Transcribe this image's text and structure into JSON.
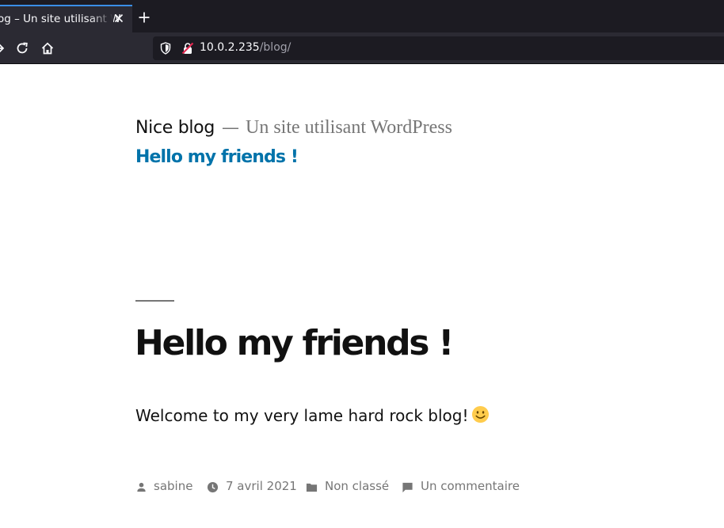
{
  "browser": {
    "tab_title": "og – Un site utilisant W",
    "url_host": "10.0.2.235",
    "url_path": "/blog/"
  },
  "site": {
    "name": "Nice blog",
    "separator": "—",
    "description": "Un site utilisant WordPress",
    "menu_item": "Hello my friends !"
  },
  "post": {
    "title": "Hello my friends !",
    "content": "Welcome to my very lame hard rock blog!",
    "emoji": "smiley-icon",
    "meta": {
      "author": "sabine",
      "date": "7 avril 2021",
      "category": "Non classé",
      "comments": "Un commentaire"
    }
  },
  "colors": {
    "link": "#0073aa",
    "text": "#111111",
    "muted": "#767676",
    "tab_accent": "#3a8ee6",
    "chrome_dark": "#1c1b22",
    "chrome": "#2b2a33"
  }
}
